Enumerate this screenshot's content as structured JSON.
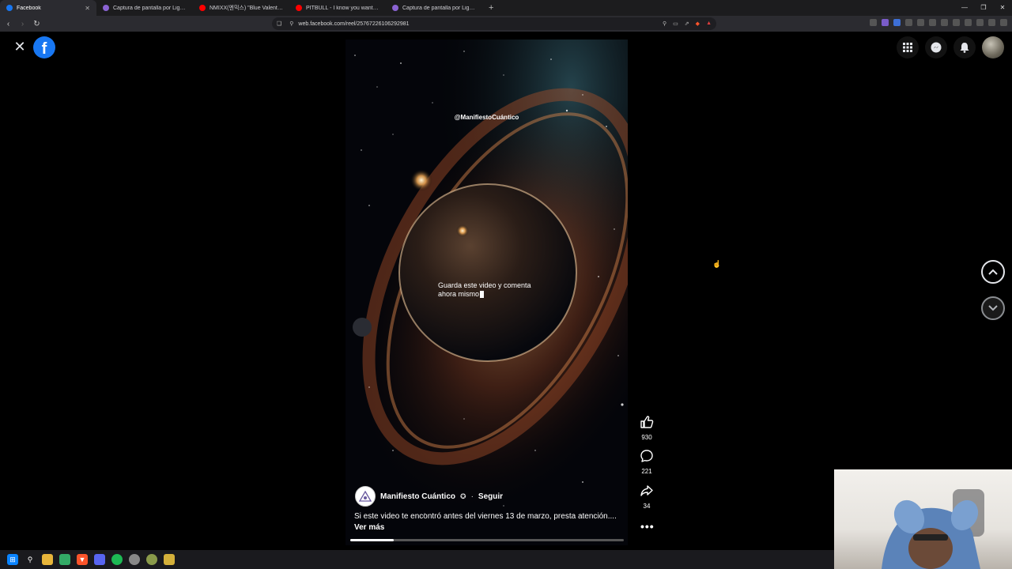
{
  "browser": {
    "tabs": [
      {
        "title": "Facebook",
        "favicon_color": "#1877f2",
        "active": true
      },
      {
        "title": "Captura de pantalla por Lightshot",
        "favicon_color": "#8a63d2",
        "active": false
      },
      {
        "title": "NMIXX(엔믹스) \"Blue Valentine\" M/V",
        "favicon_color": "#ff0000",
        "active": false
      },
      {
        "title": "PITBULL - I know you want me (calle",
        "favicon_color": "#ff0000",
        "active": false
      },
      {
        "title": "Captura de pantalla por Lightshot",
        "favicon_color": "#8a63d2",
        "active": false
      }
    ],
    "new_tab_label": "+",
    "url": "web.facebook.com/reel/2576722610629298​1"
  },
  "facebook": {
    "logo_letter": "f",
    "close_label": "✕"
  },
  "reel": {
    "watermark": "@ManifiestoCuántico",
    "overlay_caption": "Guarda este video y comenta ahora mismo",
    "author_name": "Manifiesto Cuántico",
    "follow_label": "Seguir",
    "separator": "·",
    "description": "Si este video te encontró antes del viernes 13 de marzo, presta atención....",
    "see_more_label": "Ver más",
    "progress_fraction": 0.16,
    "likes": "930",
    "comments": "221",
    "shares": "34",
    "more_label": "•••"
  },
  "colors": {
    "accent": "#1877f2",
    "background": "#000000"
  }
}
